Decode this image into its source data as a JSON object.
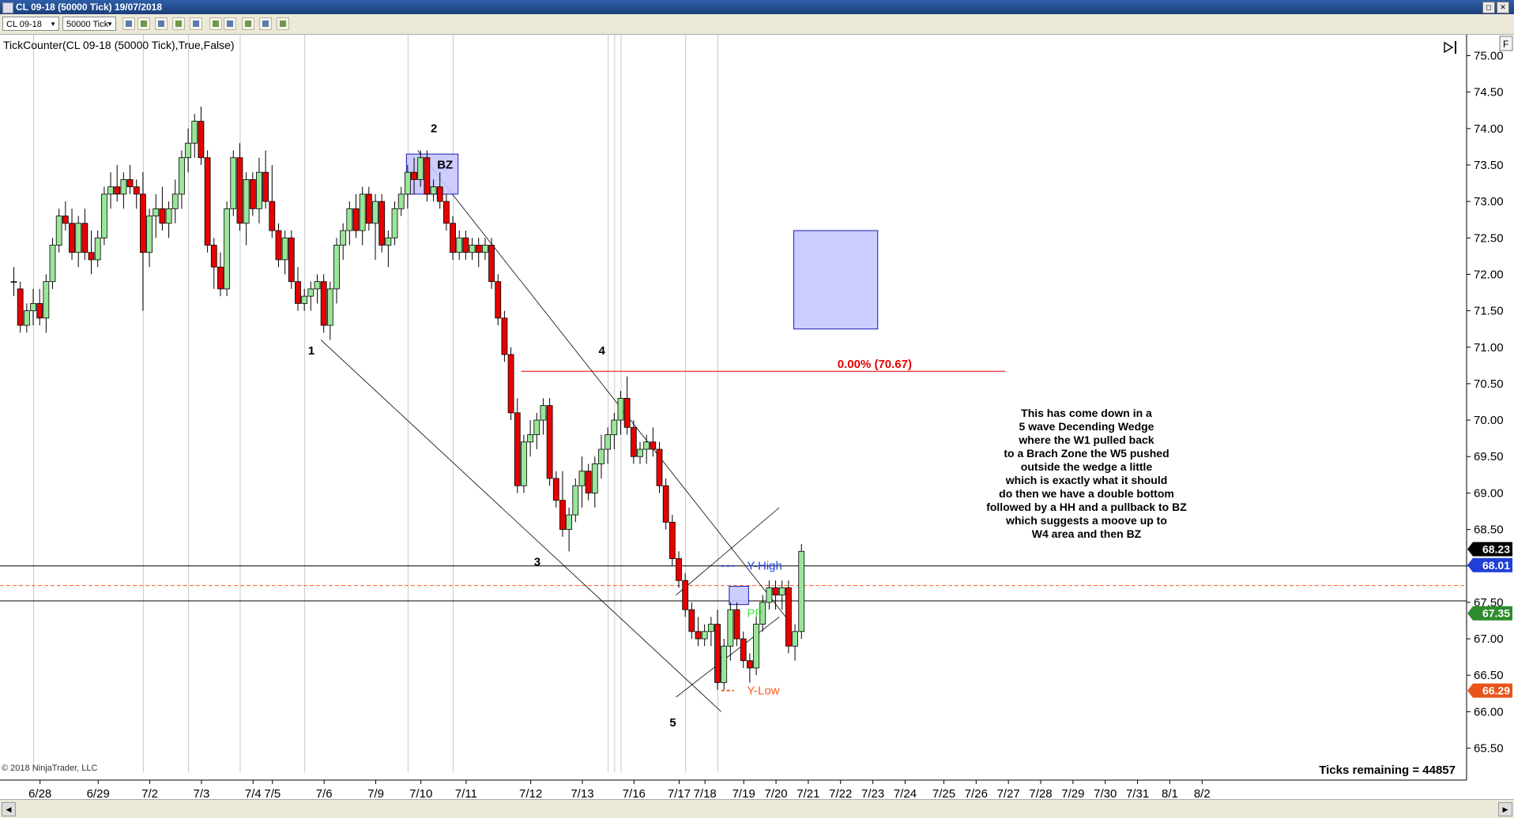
{
  "window": {
    "title": "CL 09-18 (50000 Tick)  19/07/2018",
    "btn_restore": "◻",
    "btn_close": "✕"
  },
  "toolbar": {
    "instrument": "CL 09-18",
    "interval": "50000 Tick",
    "icons": [
      "bar-chart-icon",
      "pencil-icon",
      "crosshair-icon",
      "eraser-icon",
      "cursor-icon",
      "zoom-icon",
      "strategies-icon",
      "data-box-icon",
      "properties-icon",
      "template-icon"
    ]
  },
  "indicator_label": "TickCounter(CL 09-18 (50000 Tick),True,False)",
  "copyright": "© 2018 NinjaTrader, LLC",
  "ticks_remaining": "Ticks remaining = 44857",
  "colors": {
    "up": "#99e699",
    "down": "#e60000",
    "wick": "#000000",
    "zone_fill": "#c8c8ff",
    "zone_stroke": "#1a1ab3",
    "price_box": "#000000",
    "yhigh_box": "#1f3fd6",
    "pp_box": "#2e8b2e",
    "ylow_box": "#e8541a",
    "fib_line": "#e60000"
  },
  "chart_data": {
    "type": "candlestick",
    "title": "",
    "ylim": [
      65.3,
      75.2
    ],
    "yticks": [
      "75.00",
      "74.50",
      "74.00",
      "73.50",
      "73.00",
      "72.50",
      "72.00",
      "71.50",
      "71.00",
      "70.50",
      "70.00",
      "69.50",
      "69.00",
      "68.50",
      "68.00",
      "67.50",
      "67.00",
      "66.50",
      "66.00",
      "65.50"
    ],
    "xticks": [
      "6/28",
      "6/29",
      "7/2",
      "7/3",
      "7/4",
      "7/5",
      "7/6",
      "7/9",
      "7/10",
      "7/11",
      "7/12",
      "7/13",
      "7/16",
      "7/17",
      "7/18",
      "7/19",
      "7/20",
      "7/21",
      "7/22",
      "7/23",
      "7/24",
      "7/25",
      "7/26",
      "7/27",
      "7/28",
      "7/29",
      "7/30",
      "7/31",
      "8/1",
      "8/2"
    ],
    "xtick_bar_index": [
      4,
      13,
      21,
      29,
      37,
      40,
      48,
      56,
      63,
      70,
      80,
      88,
      96,
      103,
      107,
      113,
      118,
      123,
      128,
      133,
      138,
      144,
      149,
      154,
      159,
      164,
      169,
      174,
      179,
      184
    ],
    "session_separators": [
      3,
      20,
      27,
      35,
      45,
      61,
      68,
      92,
      93,
      94,
      104,
      109
    ],
    "bars": [
      [
        71.9,
        72.1,
        71.7,
        71.9
      ],
      [
        71.8,
        71.9,
        71.2,
        71.3
      ],
      [
        71.3,
        71.6,
        71.2,
        71.5
      ],
      [
        71.5,
        71.8,
        71.3,
        71.6
      ],
      [
        71.6,
        71.8,
        71.3,
        71.4
      ],
      [
        71.4,
        72.0,
        71.2,
        71.9
      ],
      [
        71.9,
        72.5,
        71.8,
        72.4
      ],
      [
        72.4,
        72.9,
        72.3,
        72.8
      ],
      [
        72.8,
        73.0,
        72.6,
        72.7
      ],
      [
        72.7,
        72.9,
        72.2,
        72.3
      ],
      [
        72.3,
        72.8,
        72.1,
        72.7
      ],
      [
        72.7,
        72.9,
        72.2,
        72.3
      ],
      [
        72.3,
        72.6,
        72.0,
        72.2
      ],
      [
        72.2,
        72.6,
        72.1,
        72.5
      ],
      [
        72.5,
        73.2,
        72.4,
        73.1
      ],
      [
        73.1,
        73.4,
        72.9,
        73.2
      ],
      [
        73.2,
        73.5,
        73.0,
        73.1
      ],
      [
        73.1,
        73.4,
        72.9,
        73.3
      ],
      [
        73.3,
        73.5,
        73.1,
        73.2
      ],
      [
        73.2,
        73.3,
        72.9,
        73.1
      ],
      [
        73.1,
        73.4,
        71.5,
        72.3
      ],
      [
        72.3,
        72.9,
        72.1,
        72.8
      ],
      [
        72.8,
        73.1,
        72.5,
        72.9
      ],
      [
        72.9,
        73.2,
        72.6,
        72.7
      ],
      [
        72.7,
        73.0,
        72.5,
        72.9
      ],
      [
        72.9,
        73.3,
        72.7,
        73.1
      ],
      [
        73.1,
        73.7,
        72.9,
        73.6
      ],
      [
        73.6,
        74.0,
        73.4,
        73.8
      ],
      [
        73.8,
        74.2,
        73.6,
        74.1
      ],
      [
        74.1,
        74.3,
        73.5,
        73.6
      ],
      [
        73.6,
        73.7,
        72.3,
        72.4
      ],
      [
        72.4,
        72.5,
        71.8,
        72.1
      ],
      [
        72.1,
        72.3,
        71.7,
        71.8
      ],
      [
        71.8,
        73.0,
        71.7,
        72.9
      ],
      [
        72.9,
        73.7,
        72.8,
        73.6
      ],
      [
        73.6,
        73.8,
        72.6,
        72.7
      ],
      [
        72.7,
        73.4,
        72.4,
        73.3
      ],
      [
        73.3,
        73.4,
        72.8,
        72.9
      ],
      [
        72.9,
        73.6,
        72.7,
        73.4
      ],
      [
        73.4,
        73.7,
        72.9,
        73.0
      ],
      [
        73.0,
        73.5,
        72.5,
        72.6
      ],
      [
        72.6,
        72.7,
        72.1,
        72.2
      ],
      [
        72.2,
        72.6,
        72.0,
        72.5
      ],
      [
        72.5,
        72.6,
        71.8,
        71.9
      ],
      [
        71.9,
        72.1,
        71.5,
        71.6
      ],
      [
        71.6,
        71.8,
        71.5,
        71.7
      ],
      [
        71.7,
        71.9,
        71.5,
        71.8
      ],
      [
        71.8,
        72.0,
        71.6,
        71.9
      ],
      [
        71.9,
        72.0,
        71.2,
        71.3
      ],
      [
        71.3,
        71.9,
        71.1,
        71.8
      ],
      [
        71.8,
        72.5,
        71.6,
        72.4
      ],
      [
        72.4,
        72.7,
        72.2,
        72.6
      ],
      [
        72.6,
        73.0,
        72.4,
        72.9
      ],
      [
        72.9,
        73.1,
        72.5,
        72.6
      ],
      [
        72.6,
        73.2,
        72.4,
        73.1
      ],
      [
        73.1,
        73.2,
        72.6,
        72.7
      ],
      [
        72.7,
        73.1,
        72.2,
        73.0
      ],
      [
        73.0,
        73.1,
        72.3,
        72.4
      ],
      [
        72.4,
        72.6,
        72.1,
        72.5
      ],
      [
        72.5,
        73.0,
        72.4,
        72.9
      ],
      [
        72.9,
        73.2,
        72.8,
        73.1
      ],
      [
        73.1,
        73.5,
        72.9,
        73.4
      ],
      [
        73.4,
        73.6,
        73.1,
        73.3
      ],
      [
        73.3,
        73.7,
        73.2,
        73.6
      ],
      [
        73.6,
        73.7,
        73.0,
        73.1
      ],
      [
        73.1,
        73.3,
        73.0,
        73.2
      ],
      [
        73.2,
        73.4,
        72.9,
        73.0
      ],
      [
        73.0,
        73.1,
        72.6,
        72.7
      ],
      [
        72.7,
        72.8,
        72.2,
        72.3
      ],
      [
        72.3,
        72.6,
        72.2,
        72.5
      ],
      [
        72.5,
        72.6,
        72.2,
        72.3
      ],
      [
        72.3,
        72.5,
        72.2,
        72.4
      ],
      [
        72.4,
        72.5,
        72.1,
        72.3
      ],
      [
        72.3,
        72.5,
        72.2,
        72.4
      ],
      [
        72.4,
        72.5,
        71.8,
        71.9
      ],
      [
        71.9,
        72.0,
        71.3,
        71.4
      ],
      [
        71.4,
        71.5,
        70.8,
        70.9
      ],
      [
        70.9,
        71.0,
        70.0,
        70.1
      ],
      [
        70.1,
        70.3,
        69.0,
        69.1
      ],
      [
        69.1,
        69.8,
        69.0,
        69.7
      ],
      [
        69.7,
        70.0,
        69.5,
        69.8
      ],
      [
        69.8,
        70.1,
        69.6,
        70.0
      ],
      [
        70.0,
        70.3,
        69.8,
        70.2
      ],
      [
        70.2,
        70.3,
        69.1,
        69.2
      ],
      [
        69.2,
        69.3,
        68.8,
        68.9
      ],
      [
        68.9,
        69.3,
        68.4,
        68.5
      ],
      [
        68.5,
        68.8,
        68.2,
        68.7
      ],
      [
        68.7,
        69.2,
        68.6,
        69.1
      ],
      [
        69.1,
        69.5,
        68.8,
        69.3
      ],
      [
        69.3,
        69.4,
        68.9,
        69.0
      ],
      [
        69.0,
        69.5,
        68.8,
        69.4
      ],
      [
        69.4,
        69.8,
        69.2,
        69.6
      ],
      [
        69.6,
        69.9,
        69.4,
        69.8
      ],
      [
        69.8,
        70.1,
        69.6,
        70.0
      ],
      [
        70.0,
        70.4,
        69.8,
        70.3
      ],
      [
        70.3,
        70.6,
        69.8,
        69.9
      ],
      [
        69.9,
        70.0,
        69.4,
        69.5
      ],
      [
        69.5,
        69.7,
        69.4,
        69.6
      ],
      [
        69.6,
        69.8,
        69.4,
        69.7
      ],
      [
        69.7,
        69.9,
        69.5,
        69.6
      ],
      [
        69.6,
        69.7,
        69.0,
        69.1
      ],
      [
        69.1,
        69.2,
        68.5,
        68.6
      ],
      [
        68.6,
        68.7,
        68.0,
        68.1
      ],
      [
        68.1,
        68.2,
        67.7,
        67.8
      ],
      [
        67.8,
        67.9,
        67.3,
        67.4
      ],
      [
        67.4,
        67.5,
        67.0,
        67.1
      ],
      [
        67.1,
        67.3,
        66.9,
        67.0
      ],
      [
        67.0,
        67.2,
        66.9,
        67.1
      ],
      [
        67.1,
        67.3,
        66.9,
        67.2
      ],
      [
        67.2,
        67.4,
        66.3,
        66.4
      ],
      [
        66.4,
        67.0,
        66.3,
        66.9
      ],
      [
        66.9,
        67.5,
        66.7,
        67.4
      ],
      [
        67.4,
        67.5,
        66.9,
        67.0
      ],
      [
        67.0,
        67.1,
        66.6,
        66.7
      ],
      [
        66.7,
        66.8,
        66.4,
        66.6
      ],
      [
        66.6,
        67.3,
        66.5,
        67.2
      ],
      [
        67.2,
        67.6,
        67.1,
        67.5
      ],
      [
        67.5,
        67.8,
        67.4,
        67.7
      ],
      [
        67.7,
        67.8,
        67.4,
        67.6
      ],
      [
        67.6,
        67.8,
        67.4,
        67.7
      ],
      [
        67.7,
        67.8,
        66.8,
        66.9
      ],
      [
        66.9,
        67.2,
        66.7,
        67.1
      ],
      [
        67.1,
        68.3,
        67.0,
        68.2
      ]
    ],
    "price_labels": {
      "last": "68.23",
      "y_high": "68.01",
      "pp": "67.35",
      "y_low": "66.29",
      "fib": "0.00% (70.67)"
    },
    "levels": {
      "y_high": 68.0,
      "pp_line": 67.52,
      "y_low_dash": 67.73,
      "fib": 70.67
    },
    "wave_labels": [
      "1",
      "2",
      "3",
      "4",
      "5"
    ],
    "zone_label": "BZ",
    "line_labels": {
      "y_high": "Y-High",
      "pp": "PP",
      "y_low": "Y-Low"
    },
    "annotation": [
      "This has come down in a",
      "5 wave Decending Wedge",
      "where the W1 pulled back",
      "to a Brach Zone the W5 pushed",
      "outside the wedge a little",
      "which is exactly what it should",
      "do then we have a double bottom",
      "followed by a HH and a pullback to BZ",
      "which suggests a moove up to",
      "W4 area and then BZ"
    ]
  }
}
